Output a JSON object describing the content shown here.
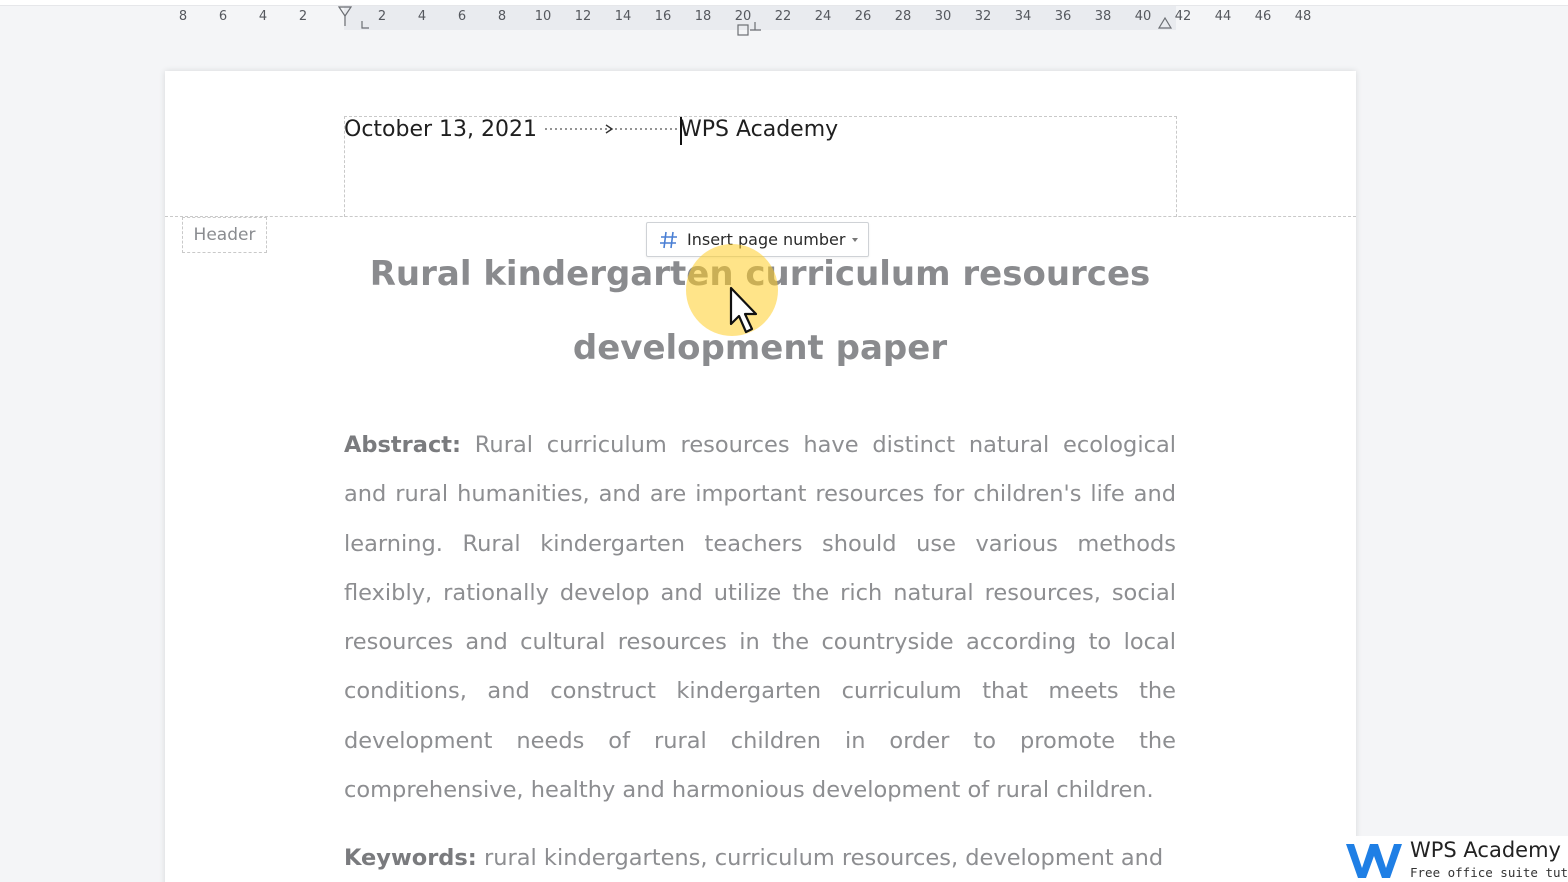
{
  "ruler": {
    "ticks": [
      "8",
      "6",
      "4",
      "2",
      "2",
      "4",
      "6",
      "8",
      "10",
      "12",
      "14",
      "16",
      "18",
      "20",
      "22",
      "24",
      "26",
      "28",
      "30",
      "32",
      "34",
      "36",
      "38",
      "40",
      "42",
      "44",
      "46",
      "48"
    ]
  },
  "header": {
    "date": "October 13, 2021",
    "right_text": "WPS Academy",
    "label": "Header"
  },
  "insert_page_number": {
    "label": "Insert page number",
    "icon": "hash-icon"
  },
  "document": {
    "title_line1": "Rural kindergarten curriculum resources",
    "title_line2": "development paper",
    "abstract_label": "Abstract:",
    "abstract_text": " Rural curriculum resources have distinct natural ecological and rural humanities, and are important resources for children's life and learning. Rural kindergarten teachers should use various methods flexibly, rationally develop and utilize the rich natural resources, social resources and cultural resources in the countryside according to local conditions, and construct kindergarten curriculum that meets the development needs of rural children in order to promote the comprehensive, healthy and harmonious development of rural children.",
    "keywords_label": "Keywords:",
    "keywords_text": " rural kindergartens, curriculum resources, development and"
  },
  "watermark": {
    "name": "WPS Academy",
    "tagline": "Free office suite tutorials",
    "logo_color": "#1f7fe5"
  },
  "colors": {
    "highlight": "#ffcd28",
    "icon_accent": "#4a7fd4"
  }
}
